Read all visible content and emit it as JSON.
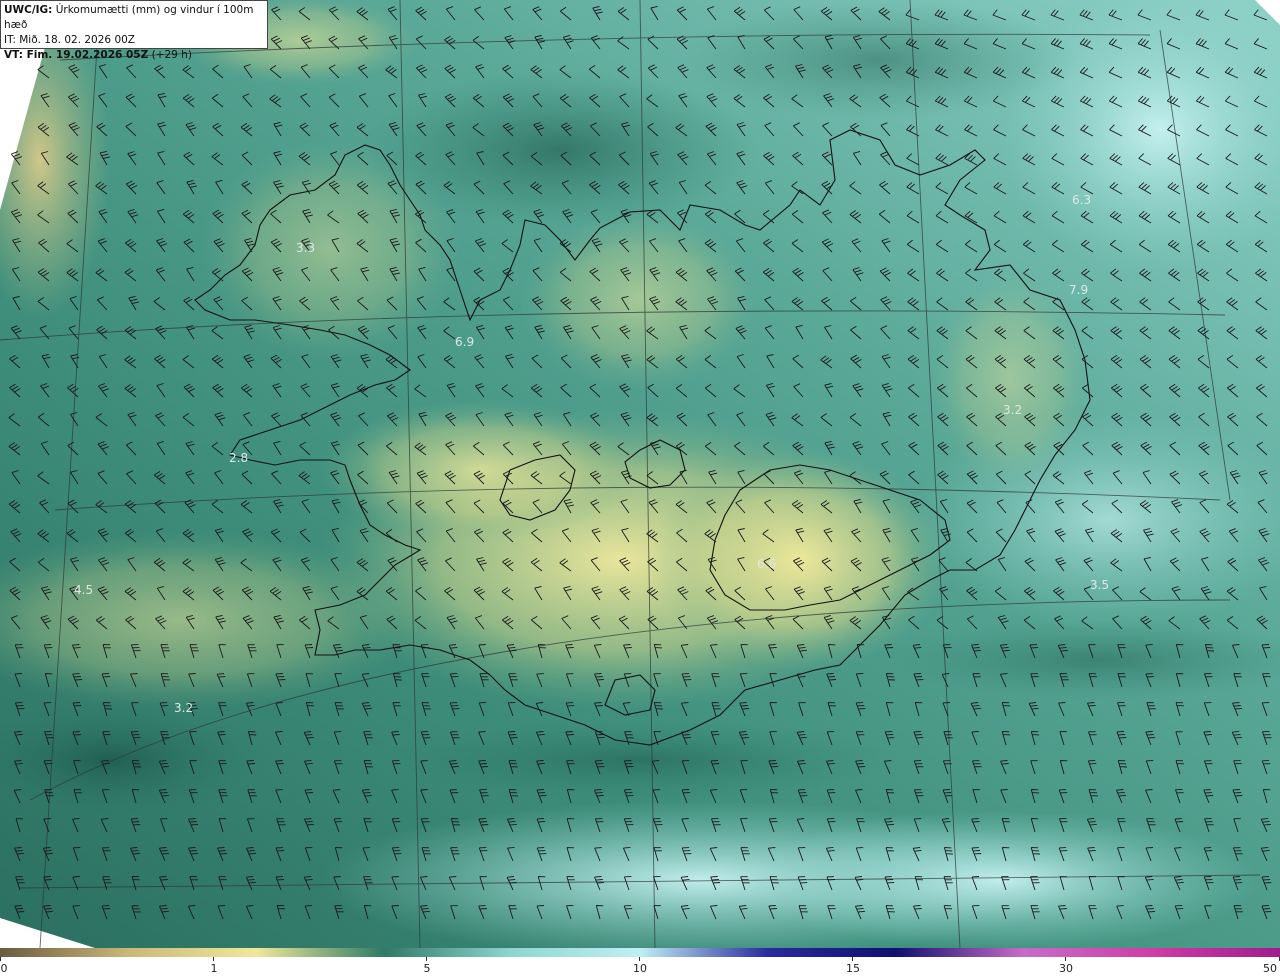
{
  "header": {
    "product_prefix": "UWC/IG:",
    "product_title": " Úrkomumætti (mm) og vindur í 100m hæð",
    "issue_time": "IT: Mið. 18. 02. 2026 00Z",
    "valid_time_prefix": "VT: Fim. 19.02.2026 05Z",
    "valid_time_offset": " (+29 h)"
  },
  "value_labels": [
    "6.3",
    "3.3",
    "6.9",
    "2.8",
    "4.5",
    "3.2",
    "3.2",
    "3.5",
    "6.6",
    "7.9"
  ],
  "colorbar": {
    "ticks": [
      "0",
      "1",
      "5",
      "10",
      "15",
      "30",
      "50"
    ],
    "colors": [
      "#6b5a3e",
      "#c9b878",
      "#efe89a",
      "#2f7a66",
      "#8fd6cf",
      "#bfeff4",
      "#2a2a9e",
      "#101070",
      "#c86bc8",
      "#d03ca8",
      "#a01c8c"
    ]
  },
  "map": {
    "region": "Iceland",
    "background_land": "#2f7b68",
    "outside_domain": "#ffffff"
  }
}
